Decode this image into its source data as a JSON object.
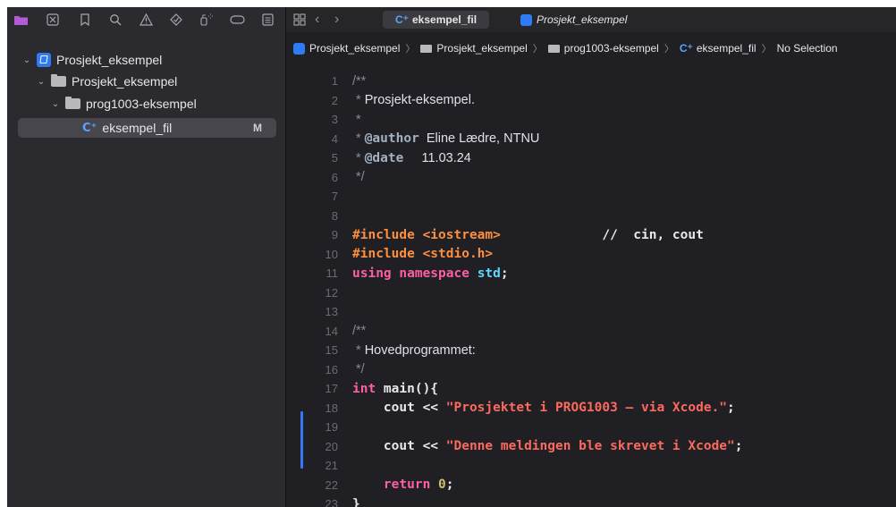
{
  "navigator": {
    "project": "Prosjekt_eksempel",
    "group": "Prosjekt_eksempel",
    "subgroup": "prog1003-eksempel",
    "file": "eksempel_fil",
    "file_badge": "M",
    "file_icon_glyph": "C⁺"
  },
  "tabs": [
    {
      "label": "eksempel_fil",
      "icon": "cpp-file-icon",
      "active": true
    },
    {
      "label": "Prosjekt_eksempel",
      "icon": "project-icon",
      "active": false
    }
  ],
  "jump_bar": {
    "items": [
      "Prosjekt_eksempel",
      "Prosjekt_eksempel",
      "prog1003-eksempel",
      "eksempel_fil",
      "No Selection"
    ],
    "separator": "〉"
  },
  "code": {
    "line_numbers": [
      "1",
      "2",
      "3",
      "4",
      "5",
      "6",
      "7",
      "8",
      "9",
      "10",
      "11",
      "12",
      "13",
      "14",
      "15",
      "16",
      "17",
      "18",
      "19",
      "20",
      "21",
      "22",
      "23"
    ],
    "l1": "/**",
    "l2_star": " * ",
    "l2_text": "Prosjekt-eksempel.",
    "l3": " *",
    "l4_star": " * ",
    "l4_tag": "@author",
    "l4_text": "  Eline Lædre, NTNU",
    "l5_star": " * ",
    "l5_tag": "@date",
    "l5_text": "     11.03.24",
    "l6": " */",
    "l9_pp": "#include <iostream>",
    "l9_comment": "             //  cin, cout",
    "l10_pp": "#include <stdio.h>",
    "l11_kw": "using namespace",
    "l11_std": "std",
    "l11_semi": ";",
    "l14": "/**",
    "l15_star": " * ",
    "l15_text": "Hovedprogrammet:",
    "l16": " */",
    "l17_kw": "int",
    "l17_fn": " main(){",
    "l18_cout": "    cout << ",
    "l18_str": "\"Prosjektet i PROG1003 – via Xcode.\"",
    "l18_semi": ";",
    "l20_cout": "    cout << ",
    "l20_str": "\"Denne meldingen ble skrevet i Xcode\"",
    "l20_semi": ";",
    "l22_kw": "    return ",
    "l22_num": "0",
    "l22_semi": ";",
    "l23": "}"
  },
  "colors": {
    "background": "#1f1f24",
    "sidebar": "#2b2b2f",
    "keyword": "#fc5fa3",
    "preprocessor": "#fd8f3f",
    "string": "#fc6a5d",
    "number": "#d0bf69",
    "change_bar": "#3478f6"
  }
}
